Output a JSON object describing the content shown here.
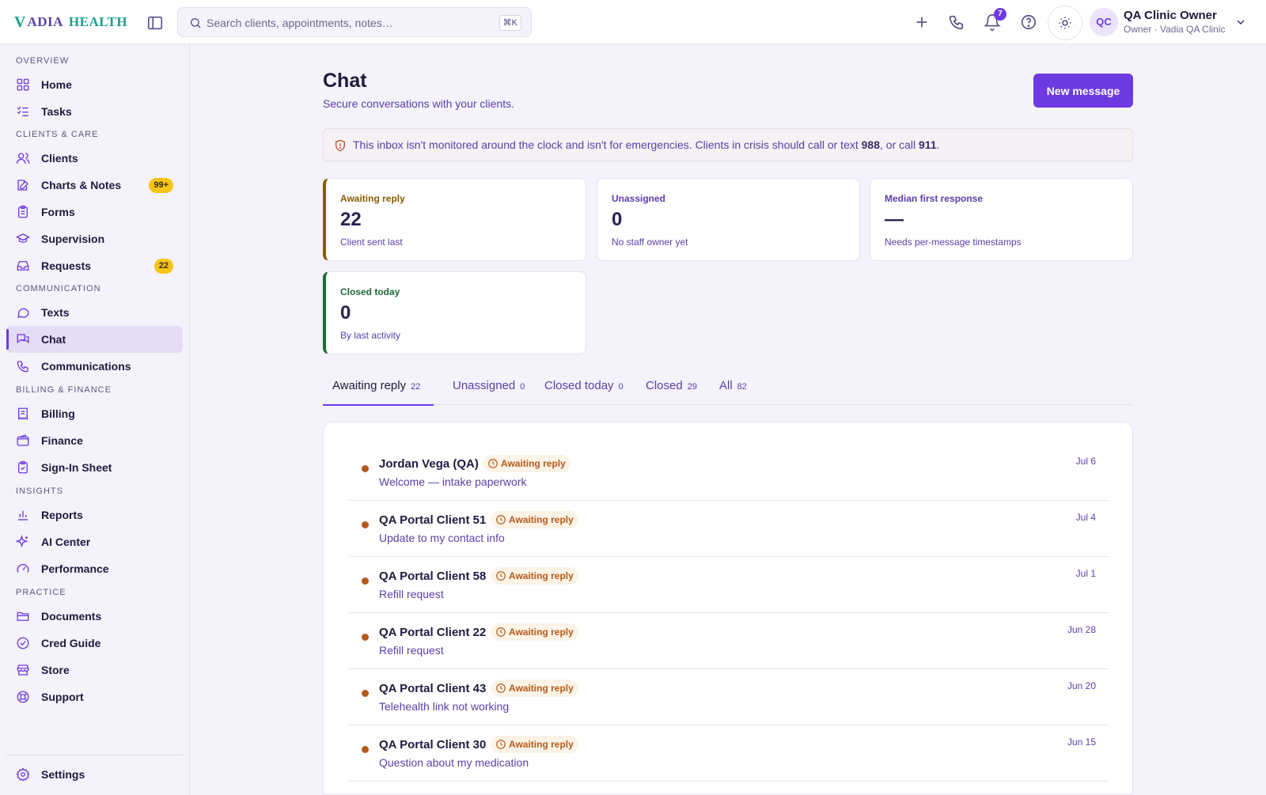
{
  "brand": {
    "logo_v": "V",
    "logo_a": "ADIA",
    "logo_h": "HEALTH"
  },
  "search": {
    "placeholder": "Search clients, appointments, notes…",
    "shortcut": "⌘K"
  },
  "topbar": {
    "notifications_count": "7"
  },
  "user": {
    "initials": "QC",
    "name": "QA Clinic Owner",
    "role": "Owner · Vadia QA Clinic"
  },
  "sidebar": {
    "sections": {
      "overview": "OVERVIEW",
      "clients_care": "CLIENTS & CARE",
      "communication": "COMMUNICATION",
      "billing_finance": "BILLING & FINANCE",
      "insights": "INSIGHTS",
      "practice": "PRACTICE"
    },
    "items": {
      "home": "Home",
      "tasks": "Tasks",
      "clients": "Clients",
      "charts_notes": "Charts & Notes",
      "charts_notes_badge": "99+",
      "forms": "Forms",
      "supervision": "Supervision",
      "requests": "Requests",
      "requests_badge": "22",
      "texts": "Texts",
      "chat": "Chat",
      "communications": "Communications",
      "billing": "Billing",
      "finance": "Finance",
      "sign_in_sheet": "Sign-In Sheet",
      "reports": "Reports",
      "ai_center": "AI Center",
      "performance": "Performance",
      "documents": "Documents",
      "cred_guide": "Cred Guide",
      "store": "Store",
      "support": "Support",
      "settings": "Settings"
    }
  },
  "page": {
    "title": "Chat",
    "subtitle": "Secure conversations with your clients.",
    "new_message": "New message",
    "alert": {
      "text_before": "This inbox isn't monitored around the clock and isn't for emergencies. Clients in crisis should call or text ",
      "num1": "988",
      "text_mid": ", or call ",
      "num2": "911",
      "text_after": "."
    }
  },
  "stats": {
    "awaiting": {
      "label": "Awaiting reply",
      "value": "22",
      "sub": "Client sent last"
    },
    "unassigned": {
      "label": "Unassigned",
      "value": "0",
      "sub": "No staff owner yet"
    },
    "median": {
      "label": "Median first response",
      "value": "—",
      "sub": "Needs per-message timestamps"
    },
    "closed_today": {
      "label": "Closed today",
      "value": "0",
      "sub": "By last activity"
    }
  },
  "tabs": [
    {
      "label": "Awaiting reply",
      "count": "22"
    },
    {
      "label": "Unassigned",
      "count": "0"
    },
    {
      "label": "Closed today",
      "count": "0"
    },
    {
      "label": "Closed",
      "count": "29"
    },
    {
      "label": "All",
      "count": "82"
    }
  ],
  "conversations": [
    {
      "name": "Jordan Vega (QA)",
      "status": "Awaiting reply",
      "subject": "Welcome — intake paperwork",
      "date": "Jul 6"
    },
    {
      "name": "QA Portal Client 51",
      "status": "Awaiting reply",
      "subject": "Update to my contact info",
      "date": "Jul 4"
    },
    {
      "name": "QA Portal Client 58",
      "status": "Awaiting reply",
      "subject": "Refill request",
      "date": "Jul 1"
    },
    {
      "name": "QA Portal Client 22",
      "status": "Awaiting reply",
      "subject": "Refill request",
      "date": "Jun 28"
    },
    {
      "name": "QA Portal Client 43",
      "status": "Awaiting reply",
      "subject": "Telehealth link not working",
      "date": "Jun 20"
    },
    {
      "name": "QA Portal Client 30",
      "status": "Awaiting reply",
      "subject": "Question about my medication",
      "date": "Jun 15"
    }
  ],
  "colors": {
    "accent": "#6d3ae0",
    "warning": "#b5591a",
    "badge": "#f5c518",
    "teal": "#1e9f8e"
  }
}
